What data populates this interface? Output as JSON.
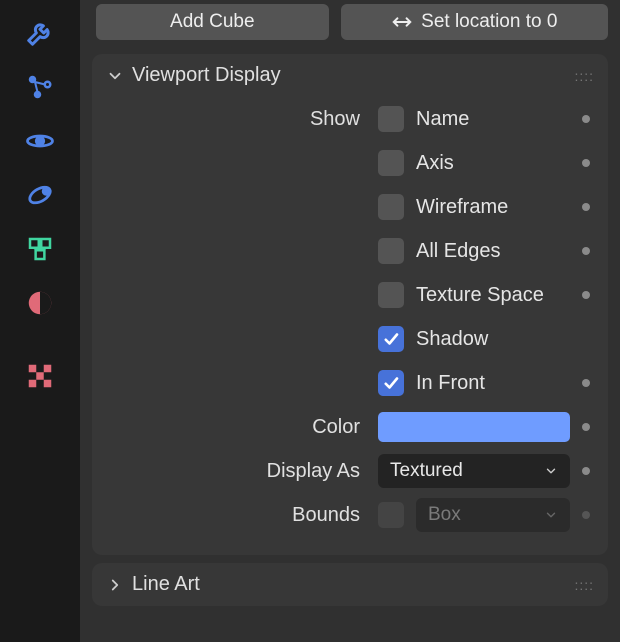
{
  "toolbar": {
    "tabs": [
      {
        "name": "modifiers",
        "color": "#4f82e6"
      },
      {
        "name": "particles",
        "color": "#4f82e6"
      },
      {
        "name": "physics",
        "color": "#4f82e6"
      },
      {
        "name": "constraints",
        "color": "#4f82e6"
      },
      {
        "name": "data",
        "color": "#40d6a0"
      },
      {
        "name": "material",
        "color": "#e06a78"
      },
      {
        "name": "texture",
        "color": "#e06a78"
      }
    ]
  },
  "ops": {
    "add_cube": "Add Cube",
    "set_loc": "Set location to 0"
  },
  "panel": {
    "title": "Viewport Display",
    "show_label": "Show",
    "color_label": "Color",
    "display_as_label": "Display As",
    "bounds_label": "Bounds",
    "options": [
      {
        "label": "Name",
        "checked": false
      },
      {
        "label": "Axis",
        "checked": false
      },
      {
        "label": "Wireframe",
        "checked": false
      },
      {
        "label": "All Edges",
        "checked": false
      },
      {
        "label": "Texture Space",
        "checked": false
      },
      {
        "label": "Shadow",
        "checked": true
      },
      {
        "label": "In Front",
        "checked": true
      }
    ],
    "color": "#6f9cff",
    "display_as": "Textured",
    "bounds_enabled": false,
    "bounds_type": "Box"
  },
  "panel2": {
    "title": "Line Art"
  }
}
